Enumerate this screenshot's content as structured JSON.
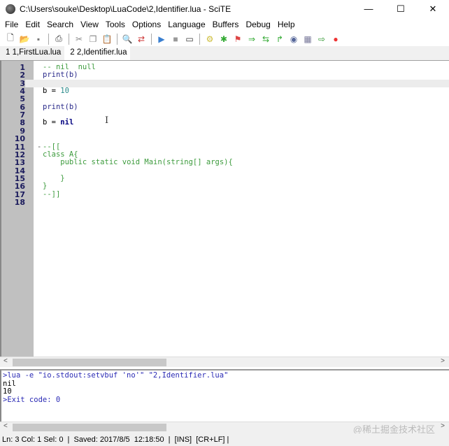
{
  "window": {
    "title": "C:\\Users\\souke\\Desktop\\LuaCode\\2,Identifier.lua - SciTE",
    "minimize": "—",
    "maximize": "☐",
    "close": "✕"
  },
  "menu": [
    "File",
    "Edit",
    "Search",
    "View",
    "Tools",
    "Options",
    "Language",
    "Buffers",
    "Debug",
    "Help"
  ],
  "toolbar": [
    "new-file",
    "open",
    "save",
    "print",
    "cut",
    "copy",
    "paste",
    "find",
    "replace",
    "run",
    "stop",
    "console",
    "compile",
    "build",
    "macro",
    "next",
    "previous",
    "jump",
    "view",
    "calc",
    "export",
    "record"
  ],
  "tabs": [
    {
      "label": "1 1,FirstLua.lua"
    },
    {
      "label": "2 2,Identifier.lua",
      "active": true
    }
  ],
  "editor": {
    "lines": [
      {
        "n": "1",
        "t": "-- nil  null",
        "c": "cm"
      },
      {
        "n": "2",
        "t": "print(b)",
        "c": "fn"
      },
      {
        "n": "3",
        "t": "",
        "c": ""
      },
      {
        "n": "4",
        "t": "b = ",
        "c": "",
        "t2": "10",
        "c2": "num"
      },
      {
        "n": "5",
        "t": "",
        "c": ""
      },
      {
        "n": "6",
        "t": "print(b)",
        "c": "fn"
      },
      {
        "n": "7",
        "t": "",
        "c": ""
      },
      {
        "n": "8",
        "t": "b = ",
        "c": "",
        "t2": "nil",
        "c2": "kw"
      },
      {
        "n": "9",
        "t": "",
        "c": ""
      },
      {
        "n": "10",
        "t": "",
        "c": ""
      },
      {
        "n": "11",
        "t": "--[[",
        "c": "cm"
      },
      {
        "n": "12",
        "t": "class A{",
        "c": "cm"
      },
      {
        "n": "13",
        "t": "    public static void Main(string[] args){",
        "c": "cm"
      },
      {
        "n": "14",
        "t": "",
        "c": ""
      },
      {
        "n": "15",
        "t": "    }",
        "c": "cm"
      },
      {
        "n": "16",
        "t": "}",
        "c": "cm"
      },
      {
        "n": "17",
        "t": "--]]",
        "c": "cm"
      },
      {
        "n": "18",
        "t": "",
        "c": ""
      }
    ],
    "fold_marker": "-"
  },
  "output": {
    "lines": [
      {
        "t": ">lua -e \"io.stdout:setvbuf 'no'\" \"2,Identifier.lua\"",
        "cmd": true
      },
      {
        "t": "nil",
        "cmd": false
      },
      {
        "t": "10",
        "cmd": false
      },
      {
        "t": ">Exit code: 0",
        "cmd": true
      }
    ]
  },
  "status": "Ln: 3 Col: 1 Sel: 0  |  Saved: 2017/8/5  12:18:50  |  [INS]  [CR+LF] |",
  "watermark": "@稀土掘金技术社区"
}
